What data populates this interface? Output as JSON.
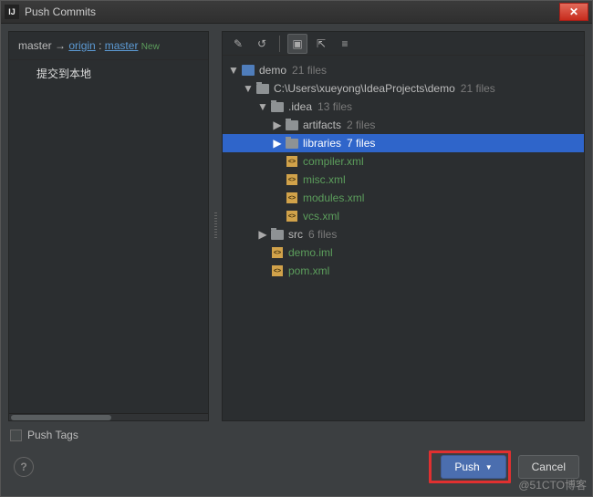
{
  "title": "Push Commits",
  "branch": {
    "local": "master",
    "arrow": "→",
    "remote": "origin",
    "sep": ":",
    "tracking": "master",
    "badge": "New"
  },
  "commits": [
    "提交到本地"
  ],
  "toolbar": {
    "edit": "✎",
    "undo": "↺",
    "group": "▣",
    "expand": "⇱",
    "collapse": "≡"
  },
  "tree": [
    {
      "d": 0,
      "t": "proj",
      "tw": "▼",
      "name": "demo",
      "meta": "21 files"
    },
    {
      "d": 1,
      "t": "folder",
      "tw": "▼",
      "name": "C:\\Users\\xueyong\\IdeaProjects\\demo",
      "meta": "21 files"
    },
    {
      "d": 2,
      "t": "folder",
      "tw": "▼",
      "name": ".idea",
      "meta": "13 files"
    },
    {
      "d": 3,
      "t": "folder",
      "tw": "▶",
      "name": "artifacts",
      "meta": "2 files"
    },
    {
      "d": 3,
      "t": "folder",
      "tw": "▶",
      "name": "libraries",
      "meta": "7 files",
      "sel": true
    },
    {
      "d": 3,
      "t": "xml",
      "tw": "",
      "name": "compiler.xml"
    },
    {
      "d": 3,
      "t": "xml",
      "tw": "",
      "name": "misc.xml"
    },
    {
      "d": 3,
      "t": "xml",
      "tw": "",
      "name": "modules.xml"
    },
    {
      "d": 3,
      "t": "xml",
      "tw": "",
      "name": "vcs.xml"
    },
    {
      "d": 2,
      "t": "folder",
      "tw": "▶",
      "name": "src",
      "meta": "6 files"
    },
    {
      "d": 2,
      "t": "xml",
      "tw": "",
      "name": "demo.iml"
    },
    {
      "d": 2,
      "t": "xml",
      "tw": "",
      "name": "pom.xml"
    }
  ],
  "push_tags": "Push Tags",
  "buttons": {
    "push": "Push",
    "cancel": "Cancel"
  },
  "watermark": "@51CTO博客"
}
